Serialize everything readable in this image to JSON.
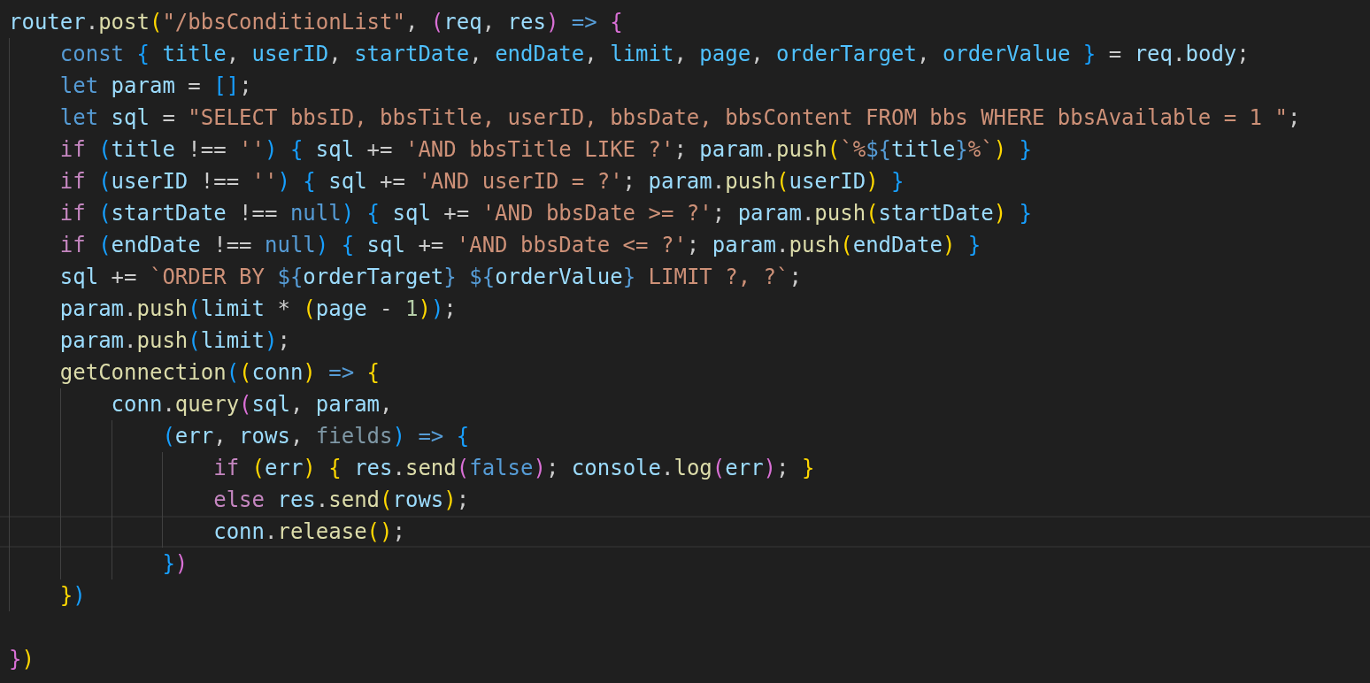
{
  "editor": {
    "lines": [
      {
        "current": false,
        "tokens": [
          {
            "kind": "var",
            "text": "router"
          },
          {
            "kind": "p",
            "text": "."
          },
          {
            "kind": "fn",
            "text": "post"
          },
          {
            "kind": "b1",
            "text": "("
          },
          {
            "kind": "str",
            "text": "\"/bbsConditionList\""
          },
          {
            "kind": "p",
            "text": ", "
          },
          {
            "kind": "b2",
            "text": "("
          },
          {
            "kind": "var",
            "text": "req"
          },
          {
            "kind": "p",
            "text": ", "
          },
          {
            "kind": "var",
            "text": "res"
          },
          {
            "kind": "b2",
            "text": ")"
          },
          {
            "kind": "kw",
            "text": " =>"
          },
          {
            "kind": "b2",
            "text": " {"
          }
        ]
      },
      {
        "current": false,
        "tokens": [
          {
            "kind": "kw",
            "text": "    const"
          },
          {
            "kind": "b3",
            "text": " {"
          },
          {
            "kind": "const",
            "text": " title"
          },
          {
            "kind": "p",
            "text": ", "
          },
          {
            "kind": "const",
            "text": "userID"
          },
          {
            "kind": "p",
            "text": ", "
          },
          {
            "kind": "const",
            "text": "startDate"
          },
          {
            "kind": "p",
            "text": ", "
          },
          {
            "kind": "const",
            "text": "endDate"
          },
          {
            "kind": "p",
            "text": ", "
          },
          {
            "kind": "const",
            "text": "limit"
          },
          {
            "kind": "p",
            "text": ", "
          },
          {
            "kind": "const",
            "text": "page"
          },
          {
            "kind": "p",
            "text": ", "
          },
          {
            "kind": "const",
            "text": "orderTarget"
          },
          {
            "kind": "p",
            "text": ", "
          },
          {
            "kind": "const",
            "text": "orderValue"
          },
          {
            "kind": "b3",
            "text": " }"
          },
          {
            "kind": "p",
            "text": " = "
          },
          {
            "kind": "var",
            "text": "req"
          },
          {
            "kind": "p",
            "text": "."
          },
          {
            "kind": "var",
            "text": "body"
          },
          {
            "kind": "p",
            "text": ";"
          }
        ]
      },
      {
        "current": false,
        "tokens": [
          {
            "kind": "kw",
            "text": "    let"
          },
          {
            "kind": "var",
            "text": " param"
          },
          {
            "kind": "p",
            "text": " = "
          },
          {
            "kind": "b3",
            "text": "["
          },
          {
            "kind": "b3",
            "text": "]"
          },
          {
            "kind": "p",
            "text": ";"
          }
        ]
      },
      {
        "current": false,
        "tokens": [
          {
            "kind": "kw",
            "text": "    let"
          },
          {
            "kind": "var",
            "text": " sql"
          },
          {
            "kind": "p",
            "text": " = "
          },
          {
            "kind": "str",
            "text": "\"SELECT bbsID, bbsTitle, userID, bbsDate, bbsContent FROM bbs WHERE bbsAvailable = 1 \""
          },
          {
            "kind": "p",
            "text": ";"
          }
        ]
      },
      {
        "current": false,
        "tokens": [
          {
            "kind": "ctrl",
            "text": "    if"
          },
          {
            "kind": "b3",
            "text": " ("
          },
          {
            "kind": "var",
            "text": "title"
          },
          {
            "kind": "p",
            "text": " !== "
          },
          {
            "kind": "str",
            "text": "''"
          },
          {
            "kind": "b3",
            "text": ")"
          },
          {
            "kind": "b3",
            "text": " {"
          },
          {
            "kind": "var",
            "text": " sql"
          },
          {
            "kind": "p",
            "text": " += "
          },
          {
            "kind": "str",
            "text": "'AND bbsTitle LIKE ?'"
          },
          {
            "kind": "p",
            "text": "; "
          },
          {
            "kind": "var",
            "text": "param"
          },
          {
            "kind": "p",
            "text": "."
          },
          {
            "kind": "fn",
            "text": "push"
          },
          {
            "kind": "b1",
            "text": "("
          },
          {
            "kind": "str",
            "text": "`%"
          },
          {
            "kind": "kw",
            "text": "${"
          },
          {
            "kind": "var",
            "text": "title"
          },
          {
            "kind": "kw",
            "text": "}"
          },
          {
            "kind": "str",
            "text": "%`"
          },
          {
            "kind": "b1",
            "text": ")"
          },
          {
            "kind": "b3",
            "text": " }"
          }
        ]
      },
      {
        "current": false,
        "tokens": [
          {
            "kind": "ctrl",
            "text": "    if"
          },
          {
            "kind": "b3",
            "text": " ("
          },
          {
            "kind": "var",
            "text": "userID"
          },
          {
            "kind": "p",
            "text": " !== "
          },
          {
            "kind": "str",
            "text": "''"
          },
          {
            "kind": "b3",
            "text": ")"
          },
          {
            "kind": "b3",
            "text": " {"
          },
          {
            "kind": "var",
            "text": " sql"
          },
          {
            "kind": "p",
            "text": " += "
          },
          {
            "kind": "str",
            "text": "'AND userID = ?'"
          },
          {
            "kind": "p",
            "text": "; "
          },
          {
            "kind": "var",
            "text": "param"
          },
          {
            "kind": "p",
            "text": "."
          },
          {
            "kind": "fn",
            "text": "push"
          },
          {
            "kind": "b1",
            "text": "("
          },
          {
            "kind": "var",
            "text": "userID"
          },
          {
            "kind": "b1",
            "text": ")"
          },
          {
            "kind": "b3",
            "text": " }"
          }
        ]
      },
      {
        "current": false,
        "tokens": [
          {
            "kind": "ctrl",
            "text": "    if"
          },
          {
            "kind": "b3",
            "text": " ("
          },
          {
            "kind": "var",
            "text": "startDate"
          },
          {
            "kind": "p",
            "text": " !== "
          },
          {
            "kind": "kw",
            "text": "null"
          },
          {
            "kind": "b3",
            "text": ")"
          },
          {
            "kind": "b3",
            "text": " {"
          },
          {
            "kind": "var",
            "text": " sql"
          },
          {
            "kind": "p",
            "text": " += "
          },
          {
            "kind": "str",
            "text": "'AND bbsDate >= ?'"
          },
          {
            "kind": "p",
            "text": "; "
          },
          {
            "kind": "var",
            "text": "param"
          },
          {
            "kind": "p",
            "text": "."
          },
          {
            "kind": "fn",
            "text": "push"
          },
          {
            "kind": "b1",
            "text": "("
          },
          {
            "kind": "var",
            "text": "startDate"
          },
          {
            "kind": "b1",
            "text": ")"
          },
          {
            "kind": "b3",
            "text": " }"
          }
        ]
      },
      {
        "current": false,
        "tokens": [
          {
            "kind": "ctrl",
            "text": "    if"
          },
          {
            "kind": "b3",
            "text": " ("
          },
          {
            "kind": "var",
            "text": "endDate"
          },
          {
            "kind": "p",
            "text": " !== "
          },
          {
            "kind": "kw",
            "text": "null"
          },
          {
            "kind": "b3",
            "text": ")"
          },
          {
            "kind": "b3",
            "text": " {"
          },
          {
            "kind": "var",
            "text": " sql"
          },
          {
            "kind": "p",
            "text": " += "
          },
          {
            "kind": "str",
            "text": "'AND bbsDate <= ?'"
          },
          {
            "kind": "p",
            "text": "; "
          },
          {
            "kind": "var",
            "text": "param"
          },
          {
            "kind": "p",
            "text": "."
          },
          {
            "kind": "fn",
            "text": "push"
          },
          {
            "kind": "b1",
            "text": "("
          },
          {
            "kind": "var",
            "text": "endDate"
          },
          {
            "kind": "b1",
            "text": ")"
          },
          {
            "kind": "b3",
            "text": " }"
          }
        ]
      },
      {
        "current": false,
        "tokens": [
          {
            "kind": "var",
            "text": "    sql"
          },
          {
            "kind": "p",
            "text": " += "
          },
          {
            "kind": "str",
            "text": "`ORDER BY "
          },
          {
            "kind": "kw",
            "text": "${"
          },
          {
            "kind": "var",
            "text": "orderTarget"
          },
          {
            "kind": "kw",
            "text": "}"
          },
          {
            "kind": "kw",
            "text": " ${"
          },
          {
            "kind": "var",
            "text": "orderValue"
          },
          {
            "kind": "kw",
            "text": "}"
          },
          {
            "kind": "str",
            "text": " LIMIT ?, ?`"
          },
          {
            "kind": "p",
            "text": ";"
          }
        ]
      },
      {
        "current": false,
        "tokens": [
          {
            "kind": "var",
            "text": "    param"
          },
          {
            "kind": "p",
            "text": "."
          },
          {
            "kind": "fn",
            "text": "push"
          },
          {
            "kind": "b3",
            "text": "("
          },
          {
            "kind": "var",
            "text": "limit"
          },
          {
            "kind": "p",
            "text": " * "
          },
          {
            "kind": "b1",
            "text": "("
          },
          {
            "kind": "var",
            "text": "page"
          },
          {
            "kind": "p",
            "text": " - "
          },
          {
            "kind": "num",
            "text": "1"
          },
          {
            "kind": "b1",
            "text": ")"
          },
          {
            "kind": "b3",
            "text": ")"
          },
          {
            "kind": "p",
            "text": ";"
          }
        ]
      },
      {
        "current": false,
        "tokens": [
          {
            "kind": "var",
            "text": "    param"
          },
          {
            "kind": "p",
            "text": "."
          },
          {
            "kind": "fn",
            "text": "push"
          },
          {
            "kind": "b3",
            "text": "("
          },
          {
            "kind": "var",
            "text": "limit"
          },
          {
            "kind": "b3",
            "text": ")"
          },
          {
            "kind": "p",
            "text": ";"
          }
        ]
      },
      {
        "current": false,
        "tokens": [
          {
            "kind": "fn",
            "text": "    getConnection"
          },
          {
            "kind": "b3",
            "text": "("
          },
          {
            "kind": "b1",
            "text": "("
          },
          {
            "kind": "var",
            "text": "conn"
          },
          {
            "kind": "b1",
            "text": ")"
          },
          {
            "kind": "kw",
            "text": " =>"
          },
          {
            "kind": "b1",
            "text": " {"
          }
        ]
      },
      {
        "current": false,
        "tokens": [
          {
            "kind": "var",
            "text": "        conn"
          },
          {
            "kind": "p",
            "text": "."
          },
          {
            "kind": "fn",
            "text": "query"
          },
          {
            "kind": "b2",
            "text": "("
          },
          {
            "kind": "var",
            "text": "sql"
          },
          {
            "kind": "p",
            "text": ", "
          },
          {
            "kind": "var",
            "text": "param"
          },
          {
            "kind": "p",
            "text": ","
          }
        ]
      },
      {
        "current": false,
        "tokens": [
          {
            "kind": "b3",
            "text": "            ("
          },
          {
            "kind": "var",
            "text": "err"
          },
          {
            "kind": "p",
            "text": ", "
          },
          {
            "kind": "var",
            "text": "rows"
          },
          {
            "kind": "p",
            "text": ", "
          },
          {
            "kind": "unused",
            "text": "fields"
          },
          {
            "kind": "b3",
            "text": ")"
          },
          {
            "kind": "kw",
            "text": " =>"
          },
          {
            "kind": "b3",
            "text": " {"
          }
        ]
      },
      {
        "current": false,
        "tokens": [
          {
            "kind": "ctrl",
            "text": "                if"
          },
          {
            "kind": "b1",
            "text": " ("
          },
          {
            "kind": "var",
            "text": "err"
          },
          {
            "kind": "b1",
            "text": ")"
          },
          {
            "kind": "b1",
            "text": " {"
          },
          {
            "kind": "var",
            "text": " res"
          },
          {
            "kind": "p",
            "text": "."
          },
          {
            "kind": "fn",
            "text": "send"
          },
          {
            "kind": "b2",
            "text": "("
          },
          {
            "kind": "kw",
            "text": "false"
          },
          {
            "kind": "b2",
            "text": ")"
          },
          {
            "kind": "p",
            "text": "; "
          },
          {
            "kind": "var",
            "text": "console"
          },
          {
            "kind": "p",
            "text": "."
          },
          {
            "kind": "fn",
            "text": "log"
          },
          {
            "kind": "b2",
            "text": "("
          },
          {
            "kind": "var",
            "text": "err"
          },
          {
            "kind": "b2",
            "text": ")"
          },
          {
            "kind": "p",
            "text": "; "
          },
          {
            "kind": "b1",
            "text": "}"
          }
        ]
      },
      {
        "current": false,
        "tokens": [
          {
            "kind": "ctrl",
            "text": "                else"
          },
          {
            "kind": "var",
            "text": " res"
          },
          {
            "kind": "p",
            "text": "."
          },
          {
            "kind": "fn",
            "text": "send"
          },
          {
            "kind": "b1",
            "text": "("
          },
          {
            "kind": "var",
            "text": "rows"
          },
          {
            "kind": "b1",
            "text": ")"
          },
          {
            "kind": "p",
            "text": ";"
          }
        ]
      },
      {
        "current": true,
        "tokens": [
          {
            "kind": "var",
            "text": "                conn"
          },
          {
            "kind": "p",
            "text": "."
          },
          {
            "kind": "fn",
            "text": "release"
          },
          {
            "kind": "b1",
            "text": "("
          },
          {
            "kind": "b1",
            "text": ")"
          },
          {
            "kind": "p",
            "text": ";"
          }
        ]
      },
      {
        "current": false,
        "tokens": [
          {
            "kind": "b3",
            "text": "            }"
          },
          {
            "kind": "b2",
            "text": ")"
          }
        ]
      },
      {
        "current": false,
        "tokens": [
          {
            "kind": "b1",
            "text": "    }"
          },
          {
            "kind": "b3",
            "text": ")"
          }
        ]
      },
      {
        "current": false
      },
      {
        "current": false,
        "tokens": [
          {
            "kind": "b2",
            "text": "}"
          },
          {
            "kind": "b1",
            "text": ")"
          }
        ]
      }
    ]
  }
}
